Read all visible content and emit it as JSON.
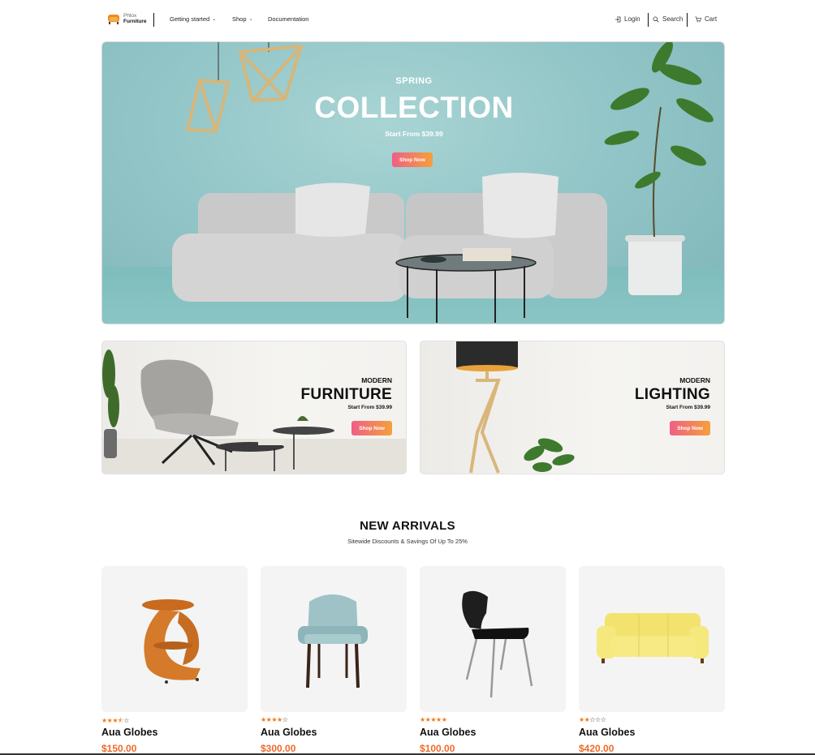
{
  "header": {
    "logo": {
      "line1": "Phlox",
      "line2": "Furniture"
    },
    "nav": [
      {
        "label": "Getting started",
        "has_dropdown": true
      },
      {
        "label": "Shop",
        "has_dropdown": true
      },
      {
        "label": "Documentation",
        "has_dropdown": false
      }
    ],
    "actions": {
      "login": "Login",
      "search": "Search",
      "cart": "Cart"
    }
  },
  "hero": {
    "eyebrow": "SPRING",
    "title": "COLLECTION",
    "subtitle": "Start From $39.99",
    "button": "Shop Now"
  },
  "promos": [
    {
      "eyebrow": "MODERN",
      "title": "FURNITURE",
      "subtitle": "Start From $39.99",
      "button": "Shop Now"
    },
    {
      "eyebrow": "MODERN",
      "title": "LIGHTING",
      "subtitle": "Start From $39.99",
      "button": "Shop Now"
    }
  ],
  "new_arrivals": {
    "title": "NEW ARRIVALS",
    "subtitle": "Sitewide Discounts & Savings Of Up To 25%",
    "products": [
      {
        "name": "Aua Globes",
        "price": "$150.00",
        "rating": 3.5,
        "image": "side-table"
      },
      {
        "name": "Aua Globes",
        "price": "$300.00",
        "rating": 4,
        "image": "armchair"
      },
      {
        "name": "Aua Globes",
        "price": "$100.00",
        "rating": 5,
        "image": "chair"
      },
      {
        "name": "Aua Globes",
        "price": "$420.00",
        "rating": 2,
        "image": "sofa"
      }
    ]
  },
  "colors": {
    "accent_gradient_start": "#ef5f86",
    "accent_gradient_end": "#f5a03b",
    "price": "#ee6a2a",
    "star": "#f07a1a",
    "hero_bg": "#93c6c8"
  }
}
